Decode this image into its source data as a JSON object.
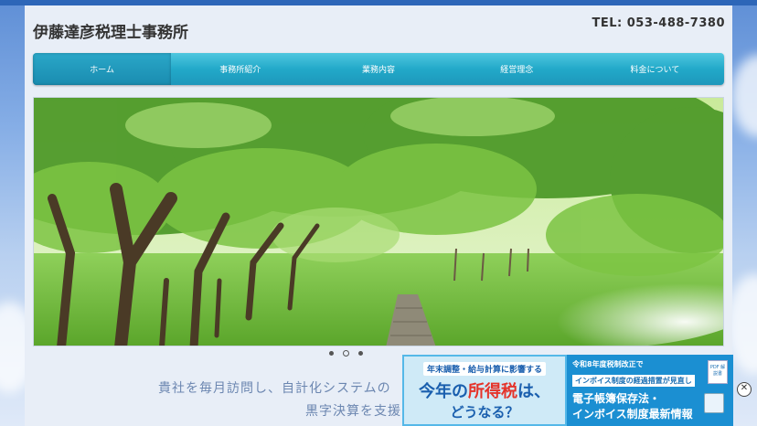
{
  "header": {
    "site_title": "伊藤達彦税理士事務所",
    "tel": "TEL: 053-488-7380"
  },
  "nav": {
    "items": [
      {
        "label": "ホーム",
        "active": true
      },
      {
        "label": "事務所紹介",
        "active": false
      },
      {
        "label": "業務内容",
        "active": false
      },
      {
        "label": "経営理念",
        "active": false
      },
      {
        "label": "料金について",
        "active": false
      }
    ]
  },
  "slider": {
    "total_slides": 3,
    "active_index": 1
  },
  "tagline": {
    "line1": "貴社を毎月訪問し、自計化システムの",
    "line2": "黒字決算を支援"
  },
  "ad": {
    "left_top": "年末調整・給与計算に影響する",
    "left_big_prefix": "今年の",
    "left_big_highlight": "所得税",
    "left_big_suffix": "は、",
    "left_big_line2": "どうなる？",
    "right_top": "令和8年度税制改正で",
    "right_badge": "インボイス制度の経過措置が見直し",
    "right_line3": "電子帳簿保存法・",
    "right_line4": "インボイス制度最新情報",
    "doc_icon_text": "PDF 解説書",
    "close_label": "✕"
  },
  "colors": {
    "nav_bg": "#22a9c9",
    "accent_blue": "#1a5fae",
    "accent_red": "#e5332a",
    "tagline": "#6b86b0"
  }
}
